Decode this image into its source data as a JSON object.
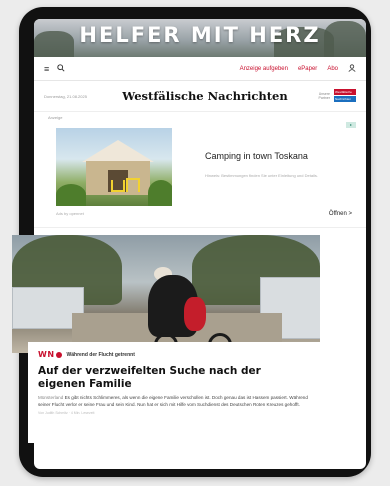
{
  "banner": {
    "title": "HELFER MIT HERZ"
  },
  "nav": {
    "menu_icon": "menu-icon",
    "search_icon": "search-icon",
    "links": [
      "Anzeige aufgeben",
      "ePaper",
      "Abo"
    ],
    "user_icon": "user-icon",
    "link_color": "#c8102e"
  },
  "masthead": {
    "date": "Donnerstag, 21.08.2025",
    "brand": "Westfälische Nachrichten",
    "partner_a": "Unsere Partner",
    "partner_b_top": "Westfälische",
    "partner_b_bottom": "Nachrichten"
  },
  "ad": {
    "label": "Anzeige",
    "title": "Camping in town Toskana",
    "text": "Hinweis: Bestimmungen finden Sie unter Einleitung und Details.",
    "source": "Ads by opennet",
    "open_label": "Öffnen >"
  },
  "article": {
    "logo": "WN",
    "kicker": "Während der Flucht getrennt",
    "headline": "Auf der verzweifelten Suche nach der eigenen Familie",
    "location": "Münsterland",
    "body": "Es gibt nichts Schlimmeres, als wenn die eigene Familie verschollen ist. Doch genau das ist Hassem passiert. Während seiner Flucht verlor er seine Frau und sein Kind. Nun hat er sich mit Hilfe vom Suchdienst des Deutschen Roten Kreuzes gehofft.",
    "byline": "Von Judith Schmitz · 4 Min. Lesezeit"
  }
}
